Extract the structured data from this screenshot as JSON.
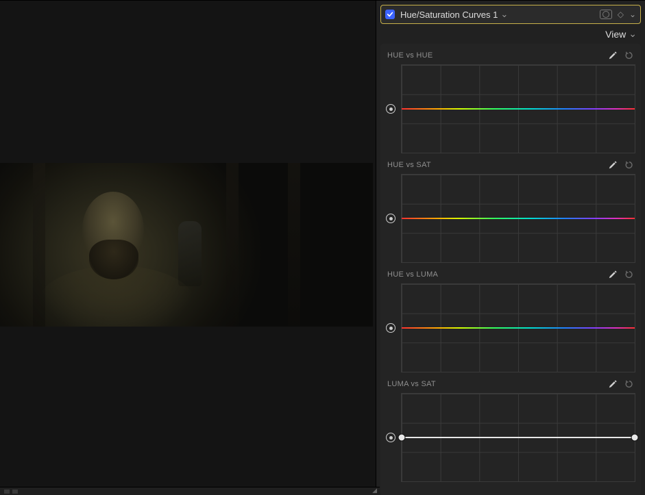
{
  "header": {
    "effect_name": "Hue/Saturation Curves 1",
    "checked": true
  },
  "view_menu_label": "View",
  "panels": [
    {
      "id": "hue-hue",
      "title": "HUE vs HUE",
      "line": "hue",
      "endpoints": false
    },
    {
      "id": "hue-sat",
      "title": "HUE vs SAT",
      "line": "hue",
      "endpoints": false
    },
    {
      "id": "hue-luma",
      "title": "HUE vs LUMA",
      "line": "hue",
      "endpoints": false
    },
    {
      "id": "luma-sat",
      "title": "LUMA vs SAT",
      "line": "luma",
      "endpoints": true
    }
  ]
}
